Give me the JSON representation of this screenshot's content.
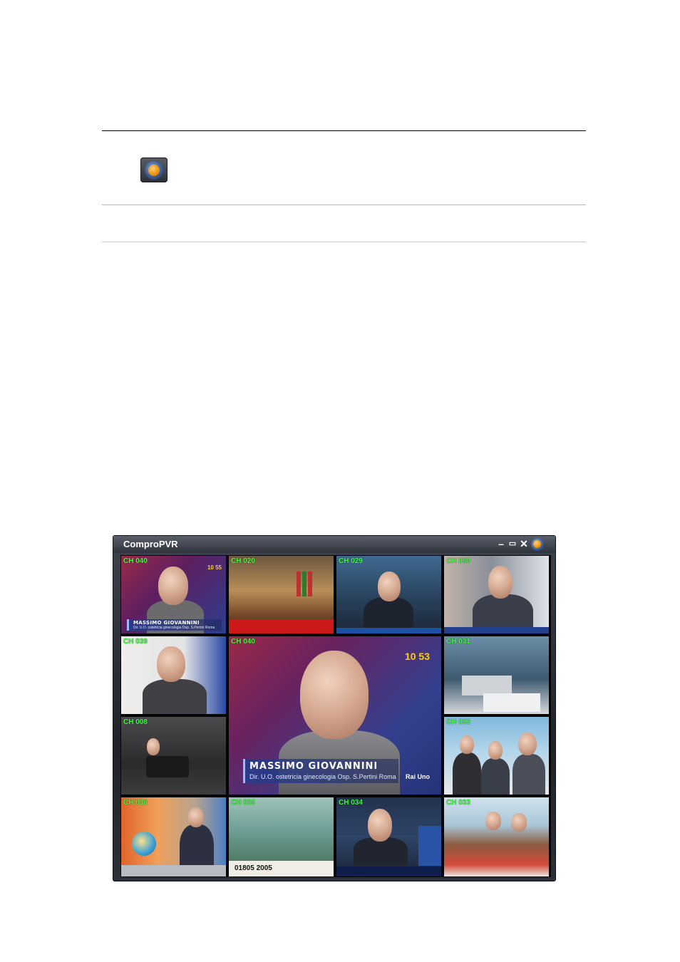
{
  "window": {
    "title": "ComproPVR",
    "controls": {
      "minimize": "–",
      "restore": "▭",
      "close": "✕"
    }
  },
  "icons": {
    "record_icon": "record-icon",
    "app_logo": "compro-logo-icon"
  },
  "tiles": [
    {
      "channel": "CH 040",
      "caption_name": "MASSIMO GIOVANNINI",
      "caption_sub": "Dir. U.O. ostetricia ginecologia Osp. S.Pertini Roma",
      "clock": "10 55",
      "brand": ""
    },
    {
      "channel": "CH 020",
      "caption_name": "",
      "caption_sub": "",
      "clock": "",
      "brand": ""
    },
    {
      "channel": "CH 029",
      "caption_name": "",
      "caption_sub": "",
      "clock": "",
      "brand": ""
    },
    {
      "channel": "CH 030",
      "caption_name": "",
      "caption_sub": "",
      "clock": "",
      "brand": ""
    },
    {
      "channel": "CH 039",
      "caption_name": "",
      "caption_sub": "",
      "clock": "",
      "brand": ""
    },
    {
      "channel": "CH 040",
      "caption_name": "MASSIMO GIOVANNINI",
      "caption_sub": "Dir. U.O. ostetricia ginecologia Osp. S.Pertini Roma",
      "clock": "10 53",
      "brand": "Rai Uno"
    },
    {
      "channel": "CH 031",
      "caption_name": "",
      "caption_sub": "",
      "clock": "",
      "brand": ""
    },
    {
      "channel": "CH 008",
      "caption_name": "",
      "caption_sub": "",
      "clock": "",
      "brand": ""
    },
    {
      "channel": "CH 032",
      "caption_name": "",
      "caption_sub": "",
      "clock": "",
      "brand": ""
    },
    {
      "channel": "CH 036",
      "caption_name": "",
      "caption_sub": "",
      "clock": "",
      "brand": ""
    },
    {
      "channel": "CH 035",
      "caption_name": "01805 2005",
      "caption_sub": "",
      "clock": "",
      "brand": ""
    },
    {
      "channel": "CH 034",
      "caption_name": "",
      "caption_sub": "",
      "clock": "",
      "brand": ""
    },
    {
      "channel": "CH 033",
      "caption_name": "",
      "caption_sub": "",
      "clock": "",
      "brand": ""
    }
  ]
}
